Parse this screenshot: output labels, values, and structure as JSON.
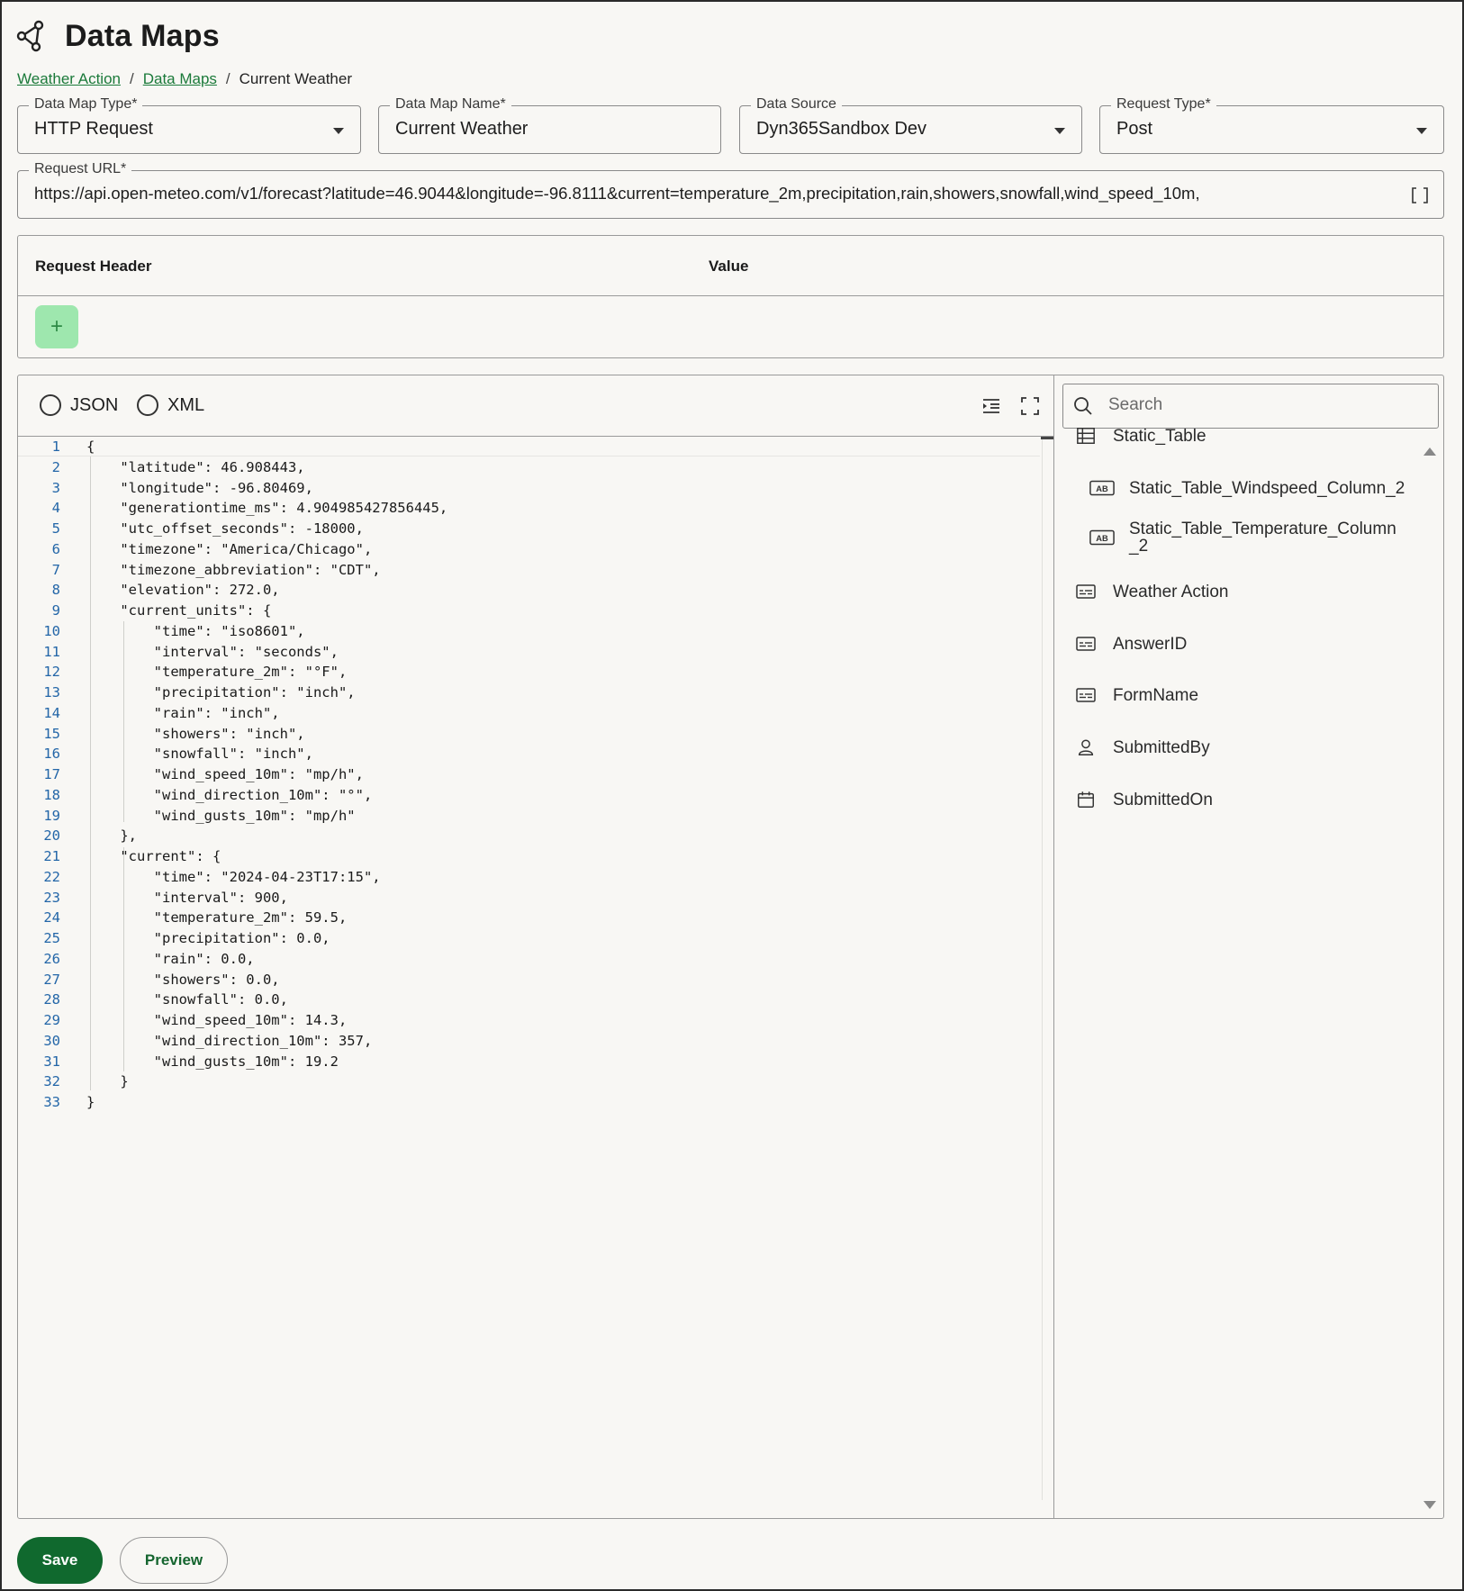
{
  "header": {
    "title": "Data Maps",
    "icon": "share-nodes-icon"
  },
  "breadcrumb": {
    "items": [
      "Weather Action",
      "Data Maps"
    ],
    "current": "Current Weather",
    "separator": "/"
  },
  "form": {
    "data_map_type": {
      "label": "Data Map Type*",
      "value": "HTTP Request"
    },
    "data_map_name": {
      "label": "Data Map Name*",
      "value": "Current Weather"
    },
    "data_source": {
      "label": "Data Source",
      "value": "Dyn365Sandbox Dev"
    },
    "request_type": {
      "label": "Request Type*",
      "value": "Post"
    },
    "request_url": {
      "label": "Request URL*",
      "value": "https://api.open-meteo.com/v1/forecast?latitude=46.9044&longitude=-96.8111&current=temperature_2m,precipitation,rain,showers,snowfall,wind_speed_10m,"
    }
  },
  "headers_table": {
    "col_header": "Request Header",
    "col_value": "Value",
    "add_label": "+"
  },
  "editor": {
    "format_options": [
      "JSON",
      "XML"
    ],
    "lines": [
      "{",
      "    \"latitude\": 46.908443,",
      "    \"longitude\": -96.80469,",
      "    \"generationtime_ms\": 4.904985427856445,",
      "    \"utc_offset_seconds\": -18000,",
      "    \"timezone\": \"America/Chicago\",",
      "    \"timezone_abbreviation\": \"CDT\",",
      "    \"elevation\": 272.0,",
      "    \"current_units\": {",
      "        \"time\": \"iso8601\",",
      "        \"interval\": \"seconds\",",
      "        \"temperature_2m\": \"°F\",",
      "        \"precipitation\": \"inch\",",
      "        \"rain\": \"inch\",",
      "        \"showers\": \"inch\",",
      "        \"snowfall\": \"inch\",",
      "        \"wind_speed_10m\": \"mp/h\",",
      "        \"wind_direction_10m\": \"°\",",
      "        \"wind_gusts_10m\": \"mp/h\"",
      "    },",
      "    \"current\": {",
      "        \"time\": \"2024-04-23T17:15\",",
      "        \"interval\": 900,",
      "        \"temperature_2m\": 59.5,",
      "        \"precipitation\": 0.0,",
      "        \"rain\": 0.0,",
      "        \"showers\": 0.0,",
      "        \"snowfall\": 0.0,",
      "        \"wind_speed_10m\": 14.3,",
      "        \"wind_direction_10m\": 357,",
      "        \"wind_gusts_10m\": 19.2",
      "    }",
      "}"
    ]
  },
  "fields_panel": {
    "search_placeholder": "Search",
    "items": [
      {
        "label": "Static_Table",
        "icon": "table-icon"
      },
      {
        "label": "Static_Table_Windspeed_Column_2",
        "icon": "text-field-icon"
      },
      {
        "label": "Static_Table_Temperature_Column_2",
        "icon": "text-field-icon"
      },
      {
        "label": "Weather Action",
        "icon": "form-field-icon"
      },
      {
        "label": "AnswerID",
        "icon": "form-field-icon"
      },
      {
        "label": "FormName",
        "icon": "form-field-icon"
      },
      {
        "label": "SubmittedBy",
        "icon": "user-icon"
      },
      {
        "label": "SubmittedOn",
        "icon": "calendar-icon"
      }
    ]
  },
  "actions": {
    "save": "Save",
    "preview": "Preview"
  },
  "colors": {
    "accent": "#10692e",
    "link": "#1b7a3a",
    "add_button": "#9ee7ae",
    "line_numbers": "#2366a8"
  }
}
